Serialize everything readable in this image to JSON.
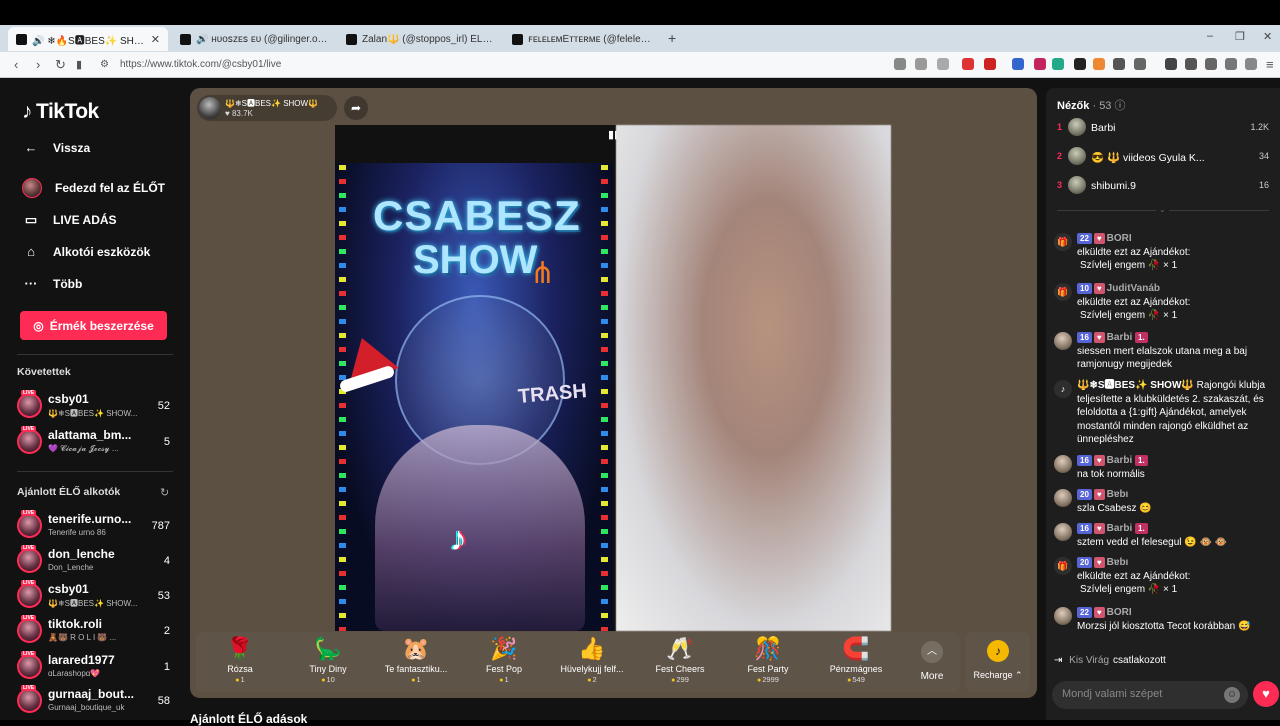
{
  "browser": {
    "tabs": [
      {
        "label": "🔊 ❄🔥S🅰BES✨ SHOW🔥 (@"
      },
      {
        "label": "🔊 ʜᴜᴏꜱᴢᴇꜱ ᴇᴜ (@gilinger.oszkr.jn) É"
      },
      {
        "label": "Zalan🔱 (@stoppos_irl) ÉLŐ ad"
      },
      {
        "label": "ꜰᴇʟᴇʟᴇᴍÉᴛᴛᴇʀᴍᴇ (@felelemetterme) É"
      }
    ],
    "tab_close": "✕",
    "new_tab": "+",
    "url": "https://www.tiktok.com/@csby01/live",
    "win_min": "–",
    "win_max": "❐",
    "win_close": "✕"
  },
  "sidebar": {
    "logo": "TikTok",
    "back_label": "Vissza",
    "nav": [
      {
        "label": "Fedezd fel az ÉLŐT",
        "icon": "avatar"
      },
      {
        "label": "LIVE ADÁS",
        "icon": "camera-icon"
      },
      {
        "label": "Alkotói eszközök",
        "icon": "creator-tools-icon"
      },
      {
        "label": "Több",
        "icon": "more-dots-icon"
      }
    ],
    "coins_button": "Érmék beszerzése",
    "following_heading": "Követettek",
    "following": [
      {
        "name": "csby01",
        "sub": "🔱❄S🅰BES✨ SHOW...",
        "count": "52"
      },
      {
        "name": "alattama_bm...",
        "sub": "💜 𝓒𝓲𝓬𝓪𝓳𝓪 𝓙𝓸𝓬𝓼𝔂 ...",
        "count": "5"
      }
    ],
    "suggested_heading": "Ajánlott ÉLŐ alkotók",
    "suggested": [
      {
        "name": "tenerife.urno...",
        "sub": "Tenerife urno 86",
        "count": "787"
      },
      {
        "name": "don_lenche",
        "sub": "Don_Lenche",
        "count": "4"
      },
      {
        "name": "csby01",
        "sub": "🔱❄S🅰BES✨ SHOW...",
        "count": "53"
      },
      {
        "name": "tiktok.roli",
        "sub": "🧸🐻 R O L I 🐻 ...",
        "count": "2"
      },
      {
        "name": "larared1977",
        "sub": "ɑLarashopɑ💖",
        "count": "1"
      },
      {
        "name": "gurnaaj_bout...",
        "sub": "Gurnaaj_boutique_uk",
        "count": "58"
      }
    ],
    "live_tag": "LIVE"
  },
  "stream": {
    "host_name": "🔱❄S🅰BES✨ SHOW🔱",
    "host_likes": "♥ 83.7K",
    "overlay_title_1": "CSABESZ",
    "overlay_title_2": "SHOW",
    "overlay_trash": "TRASH",
    "gifts": [
      {
        "name": "Rózsa",
        "price": "1",
        "icon": "🌹"
      },
      {
        "name": "Tiny Diny",
        "price": "10",
        "icon": "🦕"
      },
      {
        "name": "Te fantasztiku...",
        "price": "1",
        "icon": "🐹"
      },
      {
        "name": "Fest Pop",
        "price": "1",
        "icon": "🎉"
      },
      {
        "name": "Hüvelykujj felf...",
        "price": "2",
        "icon": "👍"
      },
      {
        "name": "Fest Cheers",
        "price": "299",
        "icon": "🥂"
      },
      {
        "name": "Fest Party",
        "price": "2999",
        "icon": "🎊"
      },
      {
        "name": "Pénzmágnes",
        "price": "549",
        "icon": "🧲"
      }
    ],
    "more_label": "More",
    "recharge_label": "Recharge ⌃",
    "section_below": "Ajánlott ÉLŐ adások"
  },
  "panel": {
    "viewers_label": "Nézők",
    "viewers_count": "· 53",
    "viewers": [
      {
        "rank": "1",
        "name": "Barbi",
        "score": "1.2K"
      },
      {
        "rank": "2",
        "name": "😎 🔱 viideos Gyula K...",
        "score": "34"
      },
      {
        "rank": "3",
        "name": "shibumi.9",
        "score": "16"
      }
    ],
    "messages": [
      {
        "level": "22",
        "fan": "♥",
        "user": "BORI",
        "line1": "elküldte ezt az Ajándékot:",
        "line2": "Szívlelj engem 🥀 × 1"
      },
      {
        "level": "10",
        "fan": "♥",
        "user": "JuditVanáb",
        "line1": "elküldte ezt az Ajándékot:",
        "line2": "Szívlelj engem 🥀 × 1"
      },
      {
        "level": "16",
        "fan": "♥",
        "user": "Barbi",
        "rank": "1.",
        "text": "siessen mert elalszok utana meg a baj ramjonugy megijedek"
      },
      {
        "user": "🔱❄S🅰BES✨ SHOW🔱",
        "text": "Rajongói klubja teljesítette a klubküldetés 2. szakaszát, és feloldotta a {1:gift} Ajándékot, amelyek mostantól minden rajongó elküldhet az ünnepléshez"
      },
      {
        "level": "16",
        "fan": "♥",
        "user": "Barbi",
        "rank": "1.",
        "text": "na tok normális"
      },
      {
        "level": "20",
        "fan": "♥",
        "user": "Bɐbı",
        "text": "szla Csabesz 😊"
      },
      {
        "level": "16",
        "fan": "♥",
        "user": "Barbi",
        "rank": "1.",
        "text": "sztem vedd el felesegul 😉 🐵 🐵"
      },
      {
        "level": "20",
        "fan": "♥",
        "user": "Bɐbı",
        "line1": "elküldte ezt az Ajándékot:",
        "line2": "Szívlelj engem 🥀 × 1"
      },
      {
        "level": "22",
        "fan": "♥",
        "user": "BORI",
        "text": "Morzsi jól kiosztotta Tecot korábban 😅"
      }
    ],
    "join_name": "Kis Virág",
    "join_text": "csatlakozott",
    "chat_placeholder": "Mondj valami szépet"
  }
}
